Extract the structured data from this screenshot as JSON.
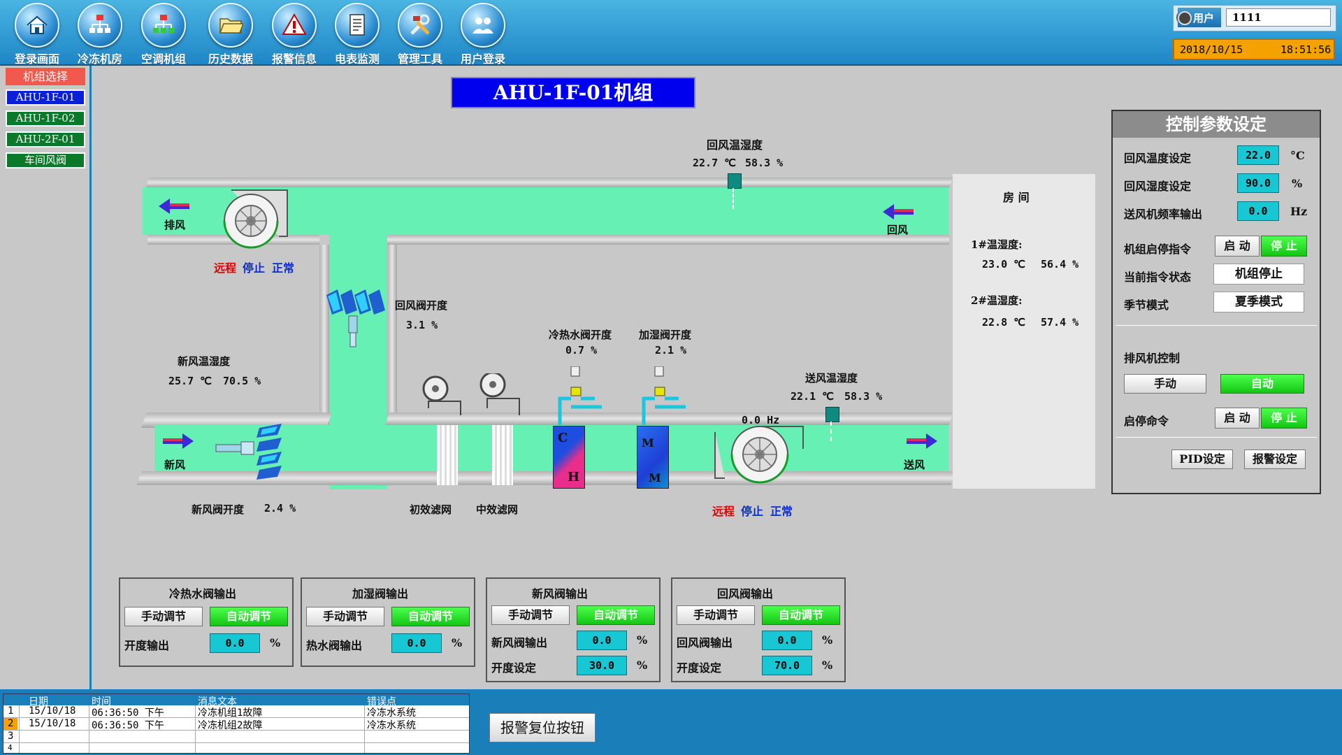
{
  "nav": {
    "items": [
      {
        "label": "登录画面",
        "icon": "home-icon"
      },
      {
        "label": "冷冻机房",
        "icon": "network-icon"
      },
      {
        "label": "空调机组",
        "icon": "network-icon"
      },
      {
        "label": "历史数据",
        "icon": "folder-icon"
      },
      {
        "label": "报警信息",
        "icon": "warning-icon"
      },
      {
        "label": "电表监测",
        "icon": "document-icon"
      },
      {
        "label": "管理工具",
        "icon": "tools-icon"
      },
      {
        "label": "用户登录",
        "icon": "users-icon"
      }
    ],
    "user_label": "用户",
    "user_value": "1111",
    "date": "2018/10/15",
    "time": "18:51:56"
  },
  "sidebar": {
    "header": "机组选择",
    "items": [
      "AHU-1F-01",
      "AHU-1F-02",
      "AHU-2F-01",
      "车间风阀"
    ]
  },
  "main": {
    "title": "AHU-1F-01机组",
    "exhaust": {
      "label": "排风",
      "mode": "远程",
      "run": "停止",
      "state": "正常"
    },
    "return_air": {
      "label": "回风",
      "th_label": "回风温湿度",
      "temp": "22.7 ℃",
      "hum": "58.3 %"
    },
    "fresh_air": {
      "label": "新风",
      "th_label": "新风温湿度",
      "temp": "25.7 ℃",
      "hum": "70.5 %",
      "valve_label": "新风阀开度",
      "valve_value": "2.4 %"
    },
    "return_valve": {
      "label": "回风阀开度",
      "value": "3.1 %"
    },
    "cooling_valve": {
      "label": "冷热水阀开度",
      "value": "0.7 %"
    },
    "humid_valve": {
      "label": "加湿阀开度",
      "value": "2.1 %"
    },
    "supply": {
      "label": "送风",
      "th_label": "送风温湿度",
      "temp": "22.1 ℃",
      "hum": "58.3 %",
      "freq": "0.0 Hz",
      "mode": "远程",
      "run": "停止",
      "state": "正常"
    },
    "filters": {
      "primary": "初效滤网",
      "medium": "中效滤网"
    },
    "coil_letters": {
      "c": "C",
      "h": "H",
      "m1": "M",
      "m2": "M"
    },
    "room": {
      "title": "房 间",
      "s1_label": "1#温湿度:",
      "s1_temp": "23.0 ℃",
      "s1_hum": "56.4 %",
      "s2_label": "2#温湿度:",
      "s2_temp": "22.8 ℃",
      "s2_hum": "57.4 %"
    }
  },
  "control": {
    "title": "控制参数设定",
    "rows": [
      {
        "label": "回风温度设定",
        "value": "22.0",
        "unit": "°C"
      },
      {
        "label": "回风湿度设定",
        "value": "90.0",
        "unit": "%"
      },
      {
        "label": "送风机频率输出",
        "value": "0.0",
        "unit": "Hz"
      }
    ],
    "start_stop_label": "机组启停指令",
    "start": "启 动",
    "stop": "停 止",
    "cmd_state_label": "当前指令状态",
    "cmd_state_value": "机组停止",
    "season_label": "季节模式",
    "season_value": "夏季模式",
    "exhaust_ctrl_label": "排风机控制",
    "manual": "手动",
    "auto": "自动",
    "exhaust_cmd_label": "启停命令",
    "pid": "PID设定",
    "alarm_set": "报警设定"
  },
  "valve_panels": [
    {
      "title": "冷热水阀输出",
      "manual": "手动调节",
      "auto": "自动调节",
      "rows": [
        {
          "label": "开度输出",
          "value": "0.0",
          "unit": "%"
        }
      ]
    },
    {
      "title": "加湿阀输出",
      "manual": "手动调节",
      "auto": "自动调节",
      "rows": [
        {
          "label": "热水阀输出",
          "value": "0.0",
          "unit": "%"
        }
      ]
    },
    {
      "title": "新风阀输出",
      "manual": "手动调节",
      "auto": "自动调节",
      "rows": [
        {
          "label": "新风阀输出",
          "value": "0.0",
          "unit": "%"
        },
        {
          "label": "开度设定",
          "value": "30.0",
          "unit": "%"
        }
      ]
    },
    {
      "title": "回风阀输出",
      "manual": "手动调节",
      "auto": "自动调节",
      "rows": [
        {
          "label": "回风阀输出",
          "value": "0.0",
          "unit": "%"
        },
        {
          "label": "开度设定",
          "value": "70.0",
          "unit": "%"
        }
      ]
    }
  ],
  "alarms": {
    "headers": [
      "日期",
      "时间",
      "消息文本",
      "错误点"
    ],
    "rows": [
      {
        "n": "1",
        "date": "15/10/18",
        "time": "06:36:50 下午",
        "text": "冷冻机组1故障",
        "point": "冷冻水系统"
      },
      {
        "n": "2",
        "date": "15/10/18",
        "time": "06:36:50 下午",
        "text": "冷冻机组2故障",
        "point": "冷冻水系统"
      },
      {
        "n": "3",
        "date": "",
        "time": "",
        "text": "",
        "point": ""
      },
      {
        "n": "4",
        "date": "",
        "time": "",
        "text": "",
        "point": ""
      }
    ],
    "reset_button": "报警复位按钮"
  },
  "colors": {
    "duct": "#66f0b4",
    "panel_bg": "#c8c8c8",
    "nav_bg": "#2a94d0",
    "title_bg": "#0000ee",
    "active_green": "#22dd22",
    "field_cyan": "#17c7d4",
    "alarm_orange": "#f5a100"
  }
}
